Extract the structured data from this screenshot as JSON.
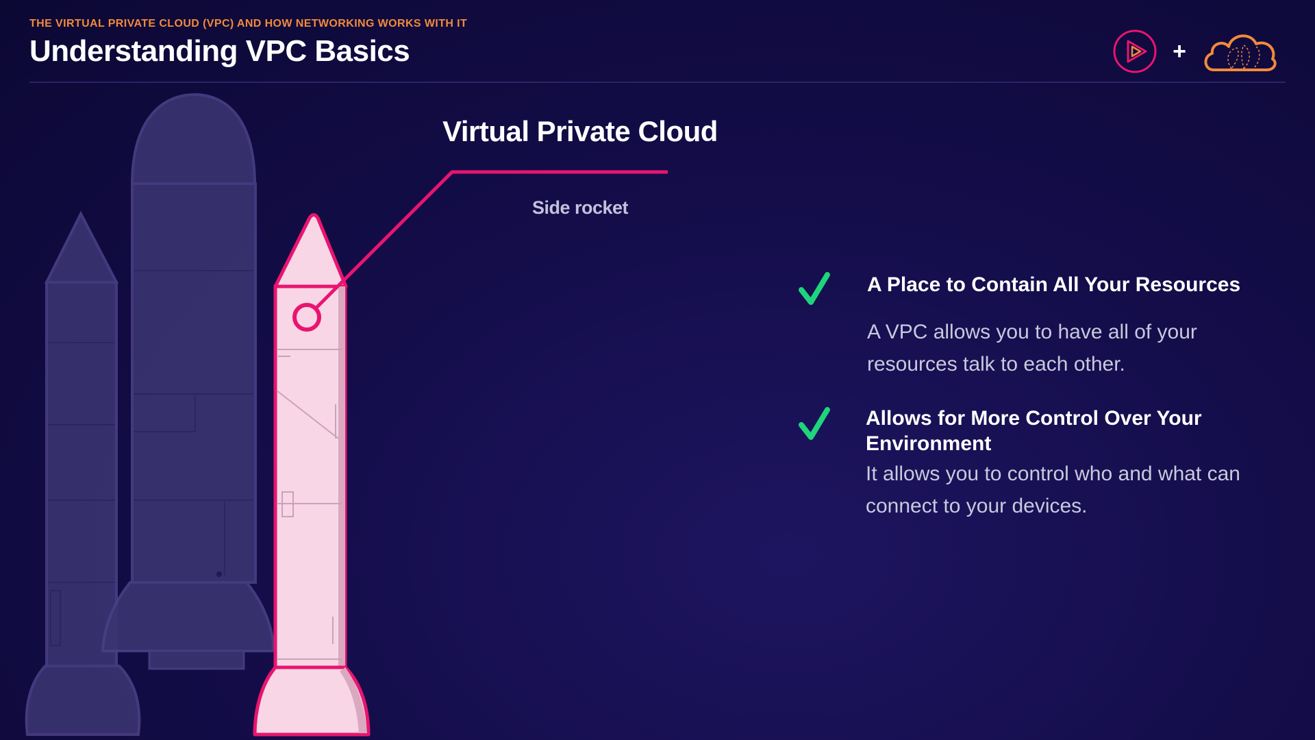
{
  "header": {
    "eyebrow": "THE VIRTUAL PRIVATE CLOUD (VPC) AND HOW NETWORKING WORKS WITH IT",
    "title": "Understanding VPC Basics"
  },
  "logos": {
    "left_icon": "play-circle-icon",
    "separator": "+",
    "right_icon": "cloud-icon"
  },
  "callout": {
    "title": "Virtual Private Cloud",
    "subtitle": "Side rocket"
  },
  "points": [
    {
      "icon": "check-icon",
      "title": "A Place to Contain All Your Resources",
      "body": "A VPC allows you to have all of your resources talk to each other."
    },
    {
      "icon": "check-icon",
      "title": "Allows for More Control Over Your Environment",
      "body": "It allows you to control who and what can connect to your devices."
    }
  ],
  "colors": {
    "background": "#140d4a",
    "accent_orange": "#f28a3b",
    "accent_pink": "#e8156f",
    "check_green": "#1fd47c",
    "rocket_fill": "#f8d6e6",
    "rocket_dim": "#3a3471"
  }
}
